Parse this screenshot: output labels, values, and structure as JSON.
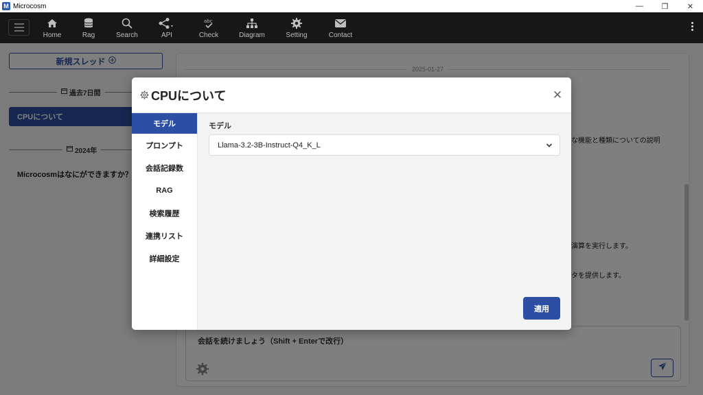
{
  "window": {
    "title": "Microcosm",
    "logo_letter": "M",
    "controls": {
      "minimize": "—",
      "restore": "❐",
      "close": "✕"
    }
  },
  "navbar": {
    "items": [
      {
        "label": "Home",
        "icon": "home-icon"
      },
      {
        "label": "Rag",
        "icon": "database-icon"
      },
      {
        "label": "Search",
        "icon": "search-icon"
      },
      {
        "label": "API",
        "icon": "share-icon"
      },
      {
        "label": "Check",
        "icon": "spellcheck-icon"
      },
      {
        "label": "Diagram",
        "icon": "sitemap-icon"
      },
      {
        "label": "Setting",
        "icon": "gear-icon"
      },
      {
        "label": "Contact",
        "icon": "envelope-icon"
      }
    ]
  },
  "sidebar": {
    "new_thread_label": "新規スレッド",
    "section_recent": "過去7日間",
    "active_thread": "CPUについて",
    "section_year": "2024年",
    "thread_2024": "Microcosmはなにができますか？"
  },
  "chat": {
    "date": "2025-01-27",
    "fragments": [
      "な機能と種類についての説明",
      "演算を実行します。",
      "タを提供します。"
    ],
    "input_placeholder": "会話を続けましょう（Shift + Enterで改行）"
  },
  "modal": {
    "title": "CPUについて",
    "close": "✕",
    "tabs": [
      "モデル",
      "プロンプト",
      "会話記録数",
      "RAG",
      "検索履歴",
      "連携リスト",
      "詳細設定"
    ],
    "active_tab": 0,
    "model_label": "モデル",
    "model_value": "Llama-3.2-3B-Instruct-Q4_K_L",
    "apply_label": "適用"
  },
  "colors": {
    "accent": "#2c4fa3",
    "navbar_bg": "#171717",
    "overlay": "rgba(0,0,0,0.5)"
  }
}
